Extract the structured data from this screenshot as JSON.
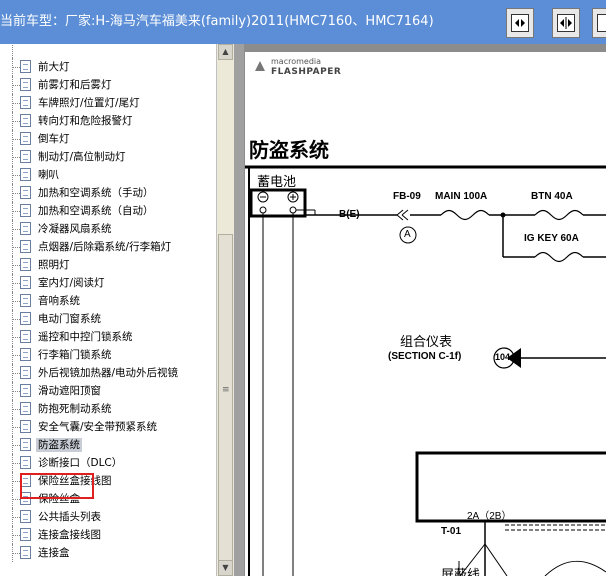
{
  "header": {
    "title": "当前车型：厂家:H-海马汽车福美来(family)2011(HMC7160、HMC7164)"
  },
  "tree": {
    "items": [
      {
        "label": "前大灯"
      },
      {
        "label": "前雾灯和后雾灯"
      },
      {
        "label": "车牌照灯/位置灯/尾灯"
      },
      {
        "label": "转向灯和危险报警灯"
      },
      {
        "label": "倒车灯"
      },
      {
        "label": "制动灯/高位制动灯"
      },
      {
        "label": "喇叭"
      },
      {
        "label": "加热和空调系统（手动）"
      },
      {
        "label": "加热和空调系统（自动）"
      },
      {
        "label": "冷凝器风扇系统"
      },
      {
        "label": "点烟器/后除霜系统/行李箱灯"
      },
      {
        "label": "照明灯"
      },
      {
        "label": "室内灯/阅读灯"
      },
      {
        "label": "音响系统"
      },
      {
        "label": "电动门窗系统"
      },
      {
        "label": "遥控和中控门锁系统"
      },
      {
        "label": "行李箱门锁系统"
      },
      {
        "label": "外后视镜加热器/电动外后视镜"
      },
      {
        "label": "滑动遮阳顶窗"
      },
      {
        "label": "防抱死制动系统"
      },
      {
        "label": "安全气囊/安全带预紧系统"
      },
      {
        "label": "防盗系统",
        "selected": true
      },
      {
        "label": "诊断接口（DLC）"
      },
      {
        "label": "保险丝盒接线图"
      },
      {
        "label": "保险丝盒"
      },
      {
        "label": "公共插头列表"
      },
      {
        "label": "连接盒接线图"
      },
      {
        "label": "连接盒"
      }
    ]
  },
  "viewer": {
    "logo_line1": "macromedia",
    "logo_line2": "FLASHPAPER",
    "page_title": "防盗系统",
    "diagram": {
      "battery": "蓄电池",
      "fb": "FB-09",
      "main": "MAIN 100A",
      "btn": "BTN 40A",
      "igkey": "IG KEY 60A",
      "be": "B(E)",
      "circle_a": "A",
      "cluster": "组合仪表",
      "section": "(SECTION C-1f)",
      "ref": "104",
      "pin": "2A（2B）",
      "conn": "T-01",
      "shield": "屏蔽线"
    }
  },
  "colors": {
    "titlebar": "#5b8ed6",
    "highlight": "#e02020"
  }
}
